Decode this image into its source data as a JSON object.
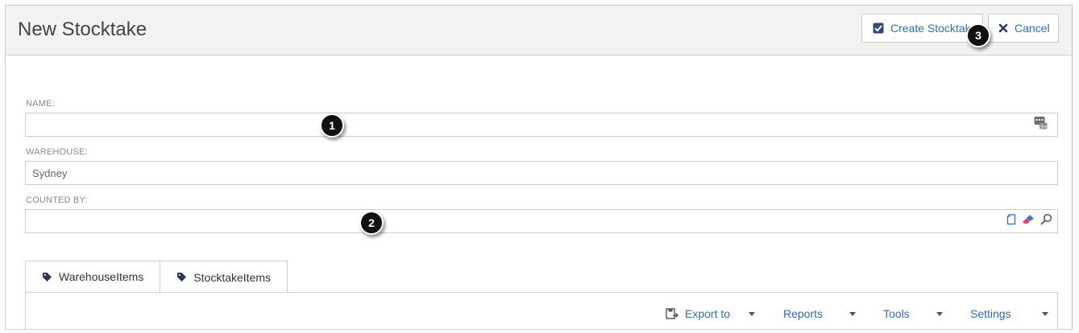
{
  "header": {
    "title": "New Stocktake",
    "create_label": "Create Stocktake",
    "cancel_label": "Cancel"
  },
  "form": {
    "name": {
      "label": "NAME:",
      "value": ""
    },
    "warehouse": {
      "label": "WAREHOUSE:",
      "value": "Sydney"
    },
    "counted_by": {
      "label": "COUNTED BY:",
      "value": ""
    }
  },
  "tabs": [
    {
      "label": "WarehouseItems",
      "icon": "tag-icon"
    },
    {
      "label": "StocktakeItems",
      "icon": "tag-icon"
    }
  ],
  "toolbar": {
    "export_label": "Export to",
    "reports_label": "Reports",
    "tools_label": "Tools",
    "settings_label": "Settings"
  },
  "annotations": [
    "1",
    "2",
    "3"
  ],
  "colors": {
    "link": "#2a6ebb",
    "header_bg": "#f2f2f2",
    "badge": "#111111",
    "eraser": "#e0447a"
  }
}
